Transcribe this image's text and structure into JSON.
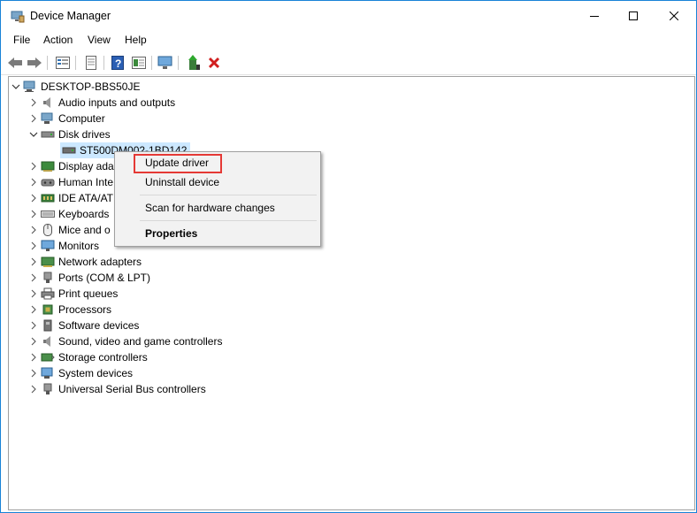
{
  "window": {
    "title": "Device Manager"
  },
  "menu": {
    "items": [
      "File",
      "Action",
      "View",
      "Help"
    ]
  },
  "toolbar": {
    "buttons": [
      "back-icon",
      "forward-icon",
      "properties-view-icon",
      "list-view-icon",
      "help-icon",
      "details-icon",
      "monitor-scan-icon",
      "add-driver-icon",
      "uninstall-x-icon"
    ]
  },
  "tree": {
    "root": "DESKTOP-BBS50JE",
    "items": [
      {
        "label": "Audio inputs and outputs",
        "icon": "speaker-icon",
        "expanded": false
      },
      {
        "label": "Computer",
        "icon": "computer-icon",
        "expanded": false
      },
      {
        "label": "Disk drives",
        "icon": "disk-icon",
        "expanded": true
      },
      {
        "label": "ST500DM002-1BD142",
        "icon": "drive-icon",
        "child": true
      },
      {
        "label": "Display ada",
        "icon": "display-icon",
        "expanded": false
      },
      {
        "label": "Human Inte",
        "icon": "hid-icon",
        "expanded": false
      },
      {
        "label": "IDE ATA/AT",
        "icon": "ide-icon",
        "expanded": false
      },
      {
        "label": "Keyboards",
        "icon": "keyboard-icon",
        "expanded": false
      },
      {
        "label": "Mice and o",
        "icon": "mouse-icon",
        "expanded": false
      },
      {
        "label": "Monitors",
        "icon": "monitor-icon",
        "expanded": false
      },
      {
        "label": "Network adapters",
        "icon": "network-icon",
        "expanded": false
      },
      {
        "label": "Ports (COM & LPT)",
        "icon": "port-icon",
        "expanded": false
      },
      {
        "label": "Print queues",
        "icon": "printer-icon",
        "expanded": false
      },
      {
        "label": "Processors",
        "icon": "processor-icon",
        "expanded": false
      },
      {
        "label": "Software devices",
        "icon": "software-icon",
        "expanded": false
      },
      {
        "label": "Sound, video and game controllers",
        "icon": "sound-icon",
        "expanded": false
      },
      {
        "label": "Storage controllers",
        "icon": "storage-icon",
        "expanded": false
      },
      {
        "label": "System devices",
        "icon": "system-icon",
        "expanded": false
      },
      {
        "label": "Universal Serial Bus controllers",
        "icon": "usb-icon",
        "expanded": false
      }
    ]
  },
  "context_menu": {
    "update_driver": "Update driver",
    "uninstall_device": "Uninstall device",
    "scan": "Scan for hardware changes",
    "properties": "Properties"
  },
  "colors": {
    "accent": "#1883d7",
    "highlight_border": "#e53935",
    "selection": "#cce8ff"
  }
}
